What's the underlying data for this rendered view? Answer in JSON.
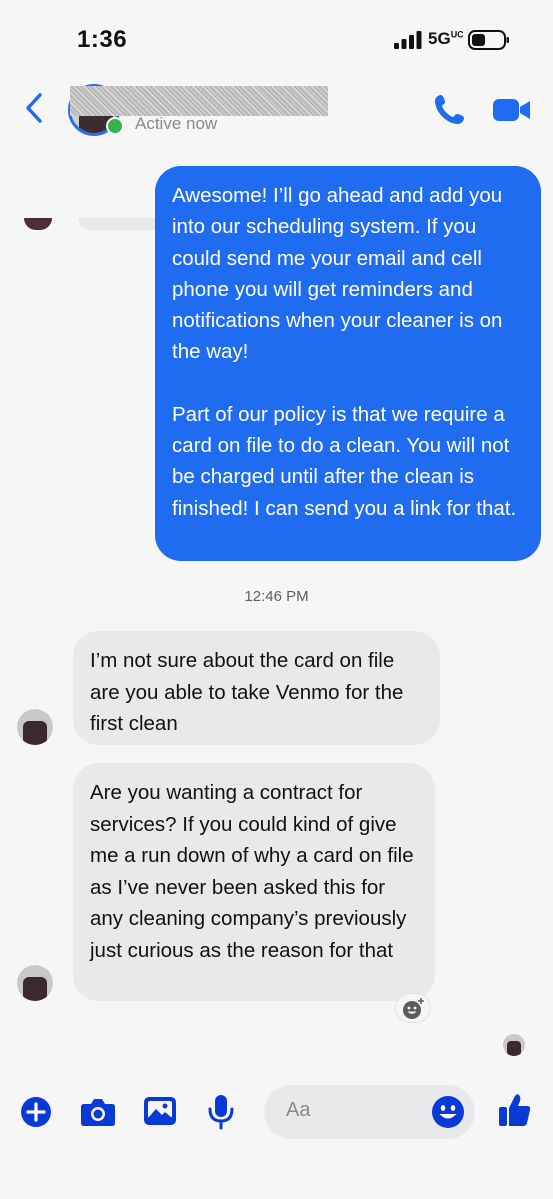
{
  "status": {
    "time": "1:36",
    "network": "5G",
    "network_sup": "UC"
  },
  "header": {
    "contact_status": "Active now"
  },
  "messages": {
    "outgoing_1_para1": "Awesome! I’ll go ahead and add you into our scheduling system. If you could send me your email and cell phone you will get reminders and notifications when your cleaner is on the way!",
    "outgoing_1_para2": "Part of our policy is that we require a card on file to do a clean. You will not be charged until after the clean is finished! I can send you a link for that.",
    "timestamp": "12:46 PM",
    "incoming_1": "I’m not sure about the card on file are you able to take Venmo for the first clean",
    "incoming_2": "Are you wanting a contract for services? If you could kind of give me a run down of why a card on file as I’ve never been asked this for any cleaning company’s previously just curious as the reason for that"
  },
  "composer": {
    "placeholder": "Aa"
  },
  "icons": [
    "back-chevron-icon",
    "phone-icon",
    "video-camera-icon",
    "plus-icon",
    "camera-icon",
    "gallery-icon",
    "microphone-icon",
    "emoji-icon",
    "thumbs-up-icon",
    "add-reaction-icon"
  ],
  "colors": {
    "accent": "#1f6cf1",
    "incoming_bubble": "#e9e9eb",
    "online": "#33b34a",
    "icon_blue": "#0a3ad6"
  }
}
